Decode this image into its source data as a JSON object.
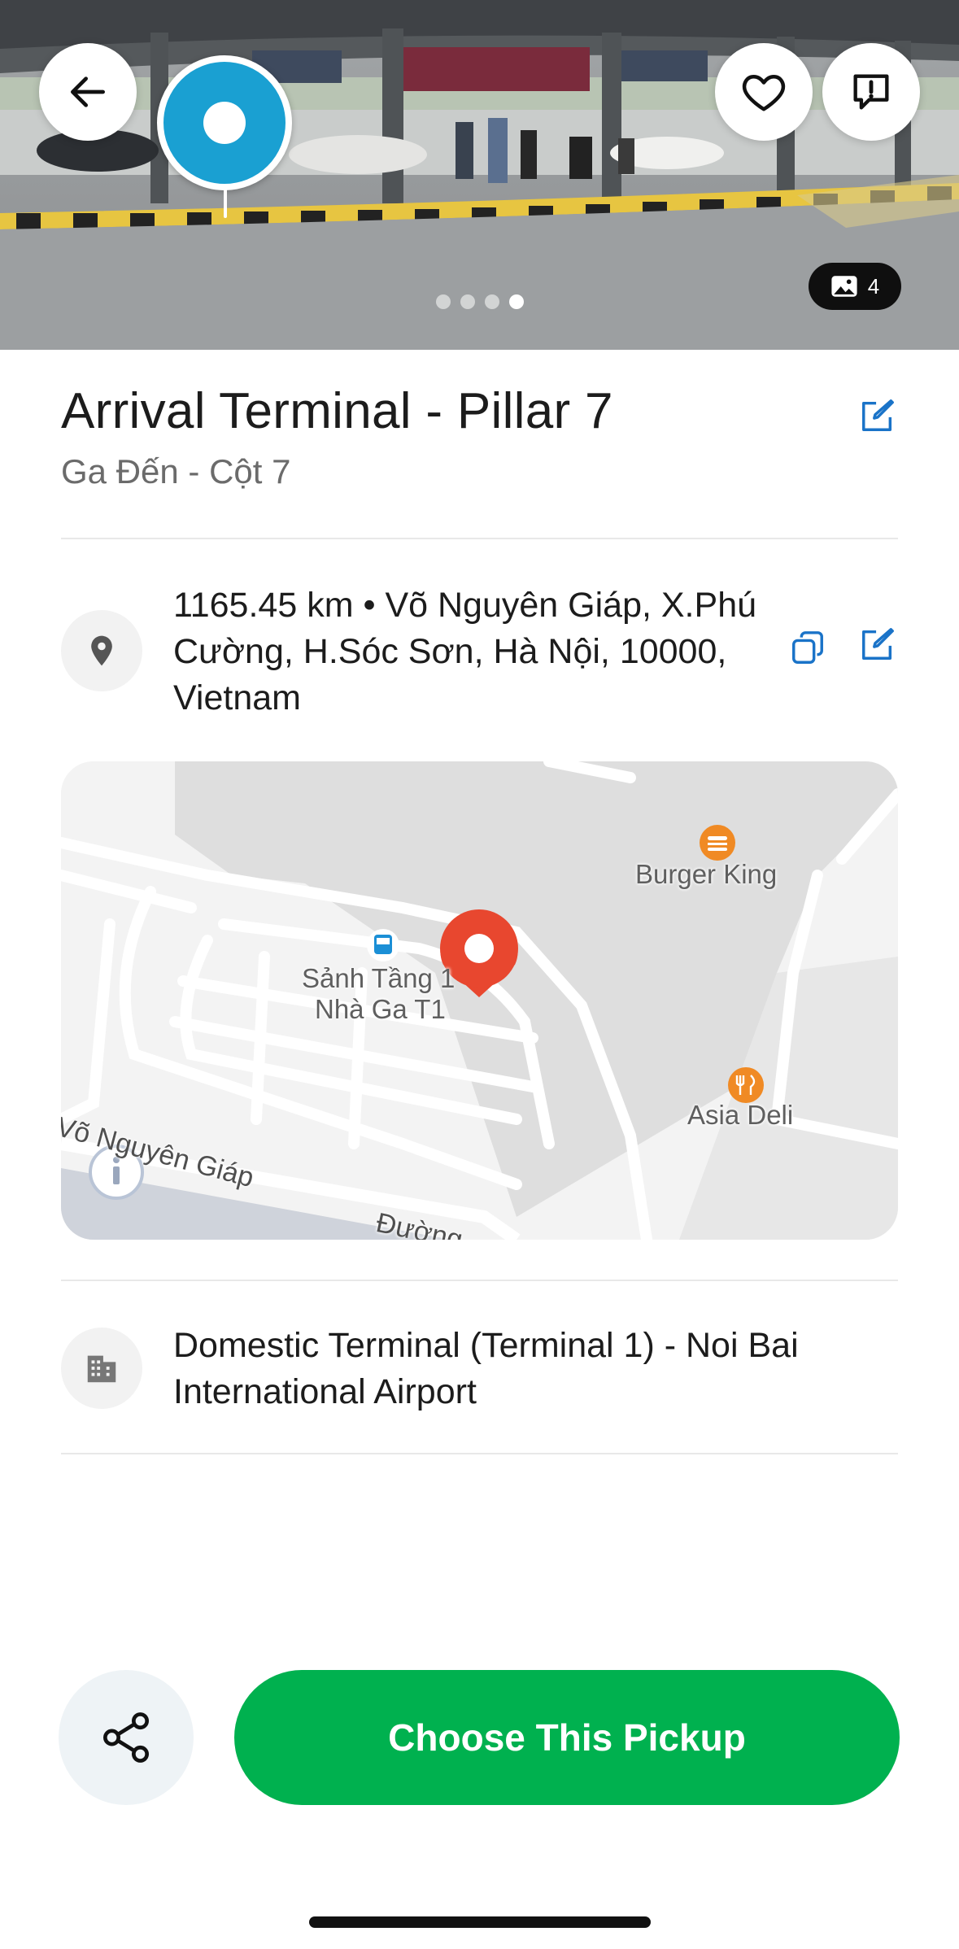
{
  "photo": {
    "count": "4",
    "pages": 4,
    "active_page": 4
  },
  "place": {
    "title": "Arrival Terminal - Pillar 7",
    "subtitle": "Ga Đến - Cột 7"
  },
  "address": {
    "text": "1165.45 km • Võ Nguyên Giáp, X.Phú Cường, H.Sóc Sơn, Hà Nội, 10000, Vietnam"
  },
  "map": {
    "poi_burger": "Burger King",
    "poi_deli": "Asia Deli",
    "poi_terminal_line1": "Sảnh Tầng 1",
    "poi_terminal_line2": "Nhà Ga T1",
    "road_main": "Võ Nguyên Giáp",
    "road_partial": "Đường"
  },
  "building": {
    "text": "Domestic Terminal (Terminal 1) - Noi Bai International Airport"
  },
  "actions": {
    "primary_label": "Choose This Pickup"
  },
  "colors": {
    "primary_green": "#00b14f",
    "link_blue": "#1a73c8",
    "pin_red": "#e8472f",
    "streetview_blue": "#1aa0d2"
  },
  "icons": {
    "back": "arrow-left-icon",
    "favorite": "heart-icon",
    "report": "report-icon",
    "photos": "image-icon",
    "edit": "edit-icon",
    "location": "location-pin-icon",
    "copy": "copy-icon",
    "building": "building-icon",
    "share": "share-icon"
  }
}
